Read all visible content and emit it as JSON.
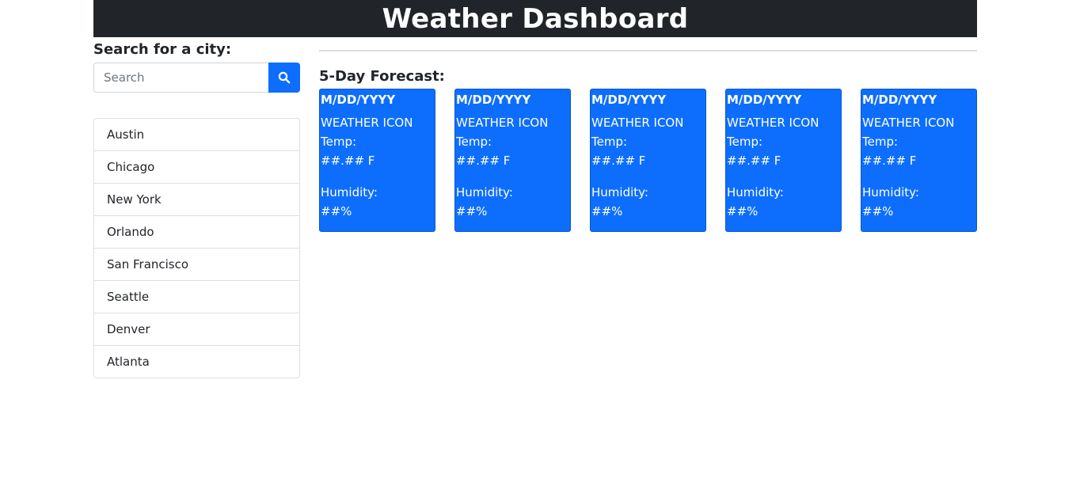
{
  "header": {
    "title": "Weather Dashboard"
  },
  "sidebar": {
    "search_label": "Search for a city:",
    "search_placeholder": "Search",
    "search_value": "",
    "search_button_icon": "search-icon",
    "cities": [
      "Austin",
      "Chicago",
      "New York",
      "Orlando",
      "San Francisco",
      "Seattle",
      "Denver",
      "Atlanta"
    ]
  },
  "main": {
    "forecast_title": "5-Day Forecast:",
    "cards": [
      {
        "date": "M/DD/YYYY",
        "icon": "WEATHER ICON",
        "temp_label": "Temp:",
        "temp_value": "##.## F",
        "humidity_label": "Humidity:",
        "humidity_value": "##%"
      },
      {
        "date": "M/DD/YYYY",
        "icon": "WEATHER ICON",
        "temp_label": "Temp:",
        "temp_value": "##.## F",
        "humidity_label": "Humidity:",
        "humidity_value": "##%"
      },
      {
        "date": "M/DD/YYYY",
        "icon": "WEATHER ICON",
        "temp_label": "Temp:",
        "temp_value": "##.## F",
        "humidity_label": "Humidity:",
        "humidity_value": "##%"
      },
      {
        "date": "M/DD/YYYY",
        "icon": "WEATHER ICON",
        "temp_label": "Temp:",
        "temp_value": "##.## F",
        "humidity_label": "Humidity:",
        "humidity_value": "##%"
      },
      {
        "date": "M/DD/YYYY",
        "icon": "WEATHER ICON",
        "temp_label": "Temp:",
        "temp_value": "##.## F",
        "humidity_label": "Humidity:",
        "humidity_value": "##%"
      }
    ]
  },
  "colors": {
    "header_bg": "#212529",
    "accent": "#0d6efd",
    "text": "#212529"
  }
}
